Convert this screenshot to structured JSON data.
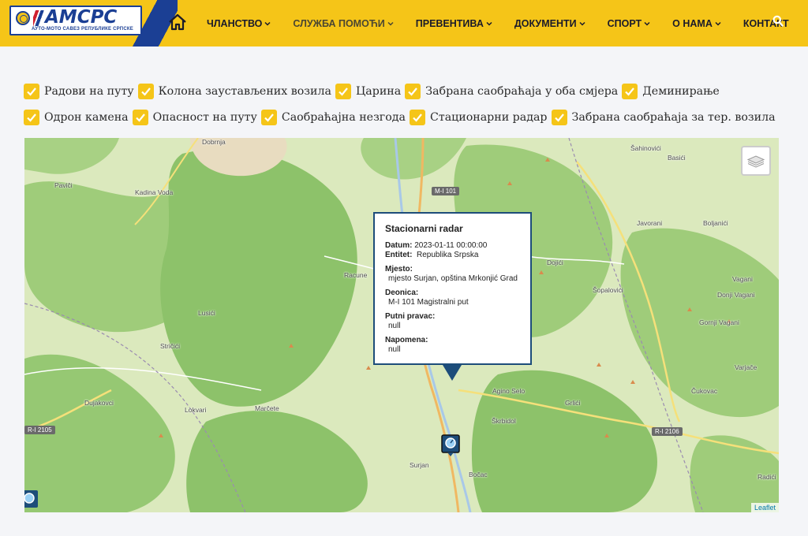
{
  "header": {
    "logo_main": "АМСРС",
    "logo_sub": "АУТО-МОТО САВЕЗ РЕПУБЛИКЕ СРПСКЕ",
    "nav": [
      {
        "label": "ЧЛАНСТВО",
        "has_dropdown": true
      },
      {
        "label": "СЛУЖБА ПОМОЋИ",
        "has_dropdown": true
      },
      {
        "label": "ПРЕВЕНТИВА",
        "has_dropdown": true
      },
      {
        "label": "ДОКУМЕНТИ",
        "has_dropdown": true
      },
      {
        "label": "СПОРТ",
        "has_dropdown": true
      },
      {
        "label": "О НАМА",
        "has_dropdown": true
      },
      {
        "label": "КОНТАКТ",
        "has_dropdown": false
      }
    ]
  },
  "filters": {
    "row1": [
      "Радови на путу",
      "Колона заустављених возила",
      "Царина",
      "Забрана саобраћаја у оба смјера",
      "Деминирање"
    ],
    "row2": [
      "Одрон камена",
      "Опасност на путу",
      "Саобраћајна незгода",
      "Стационарни радар",
      "Забрана саобраћаја за тер. возила"
    ],
    "all_checked": true
  },
  "map": {
    "places": [
      "Dobrnja",
      "Šahinovići",
      "Basići",
      "Paviči",
      "Kadina Voda",
      "Javorani",
      "Boljanići",
      "Dojići",
      "Racune",
      "Šopalovići",
      "Vagani",
      "Donji Vagani",
      "Lusići",
      "Gornji Vagani",
      "Stričići",
      "Varjače",
      "Agino Selo",
      "Čukovac",
      "Dujakovci",
      "Lokvari",
      "Marčete",
      "Grlići",
      "Škrbidol",
      "Surjan",
      "Bočac",
      "Radići"
    ],
    "roads": [
      "M-I 101",
      "R-I 2105",
      "R-I 2106"
    ],
    "attribution": "Leaflet"
  },
  "popup": {
    "title": "Stacionarni radar",
    "datum_label": "Datum:",
    "datum_value": "2023-01-11 00:00:00",
    "entitet_label": "Entitet:",
    "entitet_value": "Republika Srpska",
    "mjesto_label": "Mjesto:",
    "mjesto_value": "mjesto Surjan, opština Mrkonjić Grad",
    "deonica_label": "Deonica:",
    "deonica_value": "M-I 101 Magistralni put",
    "putni_label": "Putni pravac:",
    "putni_value": "null",
    "napomena_label": "Napomena:",
    "napomena_value": "null"
  },
  "colors": {
    "brand_yellow": "#f5c518",
    "brand_blue": "#1b3f94",
    "popup_border": "#1d4d7a"
  }
}
